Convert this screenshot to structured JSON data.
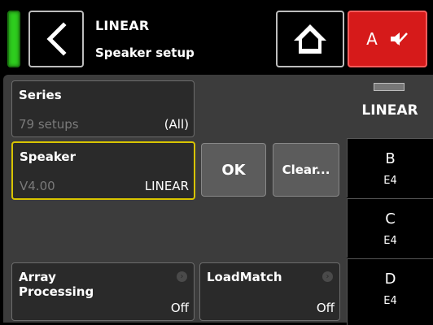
{
  "header": {
    "title": "LINEAR",
    "subtitle": "Speaker setup",
    "mute_channel": "A",
    "level_color": "#2ecc1e",
    "mute_color": "#d61a1a"
  },
  "series": {
    "label": "Series",
    "count": "79 setups",
    "value": "(All)"
  },
  "speaker": {
    "label": "Speaker",
    "version": "V4.00",
    "value": "LINEAR",
    "highlight_color": "#d8c400"
  },
  "buttons": {
    "ok": "OK",
    "clear": "Clear..."
  },
  "array": {
    "label_line1": "Array",
    "label_line2": "Processing",
    "value": "Off"
  },
  "loadmatch": {
    "label": "LoadMatch",
    "value": "Off"
  },
  "sidebar": {
    "active": "LINEAR",
    "tabs": [
      {
        "name": "B",
        "sub": "E4"
      },
      {
        "name": "C",
        "sub": "E4"
      },
      {
        "name": "D",
        "sub": "E4"
      }
    ]
  }
}
